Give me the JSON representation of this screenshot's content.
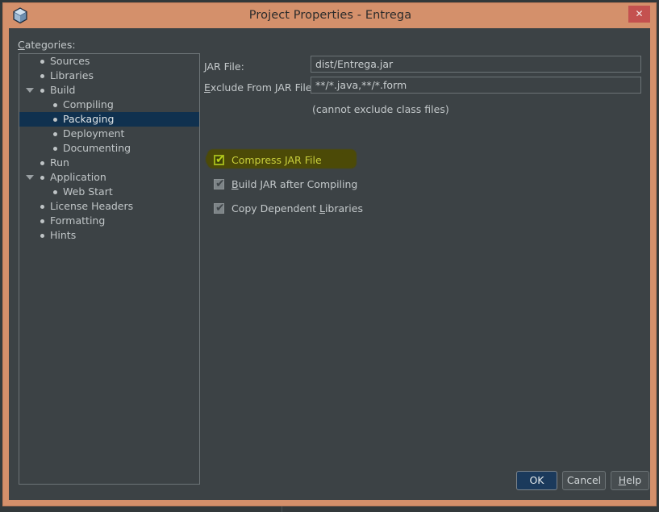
{
  "window": {
    "title": "Project Properties - Entrega",
    "app_icon": "cube-icon",
    "close_label": "✕",
    "frame_color": "#d4906b",
    "content_bg": "#3c4245"
  },
  "categories": {
    "label_prefix": "C",
    "label_rest": "ategories:",
    "items": [
      {
        "label": "Sources",
        "depth": 1,
        "expander": "",
        "selected": false
      },
      {
        "label": "Libraries",
        "depth": 1,
        "expander": "",
        "selected": false
      },
      {
        "label": "Build",
        "depth": 1,
        "expander": "expanded",
        "selected": false
      },
      {
        "label": "Compiling",
        "depth": 2,
        "expander": "",
        "selected": false
      },
      {
        "label": "Packaging",
        "depth": 2,
        "expander": "",
        "selected": true
      },
      {
        "label": "Deployment",
        "depth": 2,
        "expander": "",
        "selected": false
      },
      {
        "label": "Documenting",
        "depth": 2,
        "expander": "",
        "selected": false
      },
      {
        "label": "Run",
        "depth": 1,
        "expander": "",
        "selected": false
      },
      {
        "label": "Application",
        "depth": 1,
        "expander": "expanded",
        "selected": false
      },
      {
        "label": "Web Start",
        "depth": 2,
        "expander": "",
        "selected": false
      },
      {
        "label": "License Headers",
        "depth": 1,
        "expander": "",
        "selected": false
      },
      {
        "label": "Formatting",
        "depth": 1,
        "expander": "",
        "selected": false
      },
      {
        "label": "Hints",
        "depth": 1,
        "expander": "",
        "selected": false
      }
    ]
  },
  "form": {
    "jar_file": {
      "mnemonic": "J",
      "label_rest": "AR File:",
      "value": "dist/Entrega.jar",
      "placeholder": ""
    },
    "exclude_from_jar": {
      "mnemonic": "E",
      "label_rest": "xclude From JAR File:",
      "value": "**/*.java,**/*.form",
      "placeholder": ""
    },
    "note": "(cannot exclude class files)"
  },
  "checkboxes": [
    {
      "name": "compress-jar-file",
      "mnemonic": "",
      "label": "Compress JAR File",
      "checked": true,
      "check_glyph": "✔",
      "highlighted": true,
      "highlight_color": "#4c4a07",
      "text_color": "#c9cf3c"
    },
    {
      "name": "build-jar-after-compiling",
      "mnemonic": "B",
      "label": "Build JAR after Compiling",
      "checked": true,
      "check_glyph": "✔",
      "highlighted": false
    },
    {
      "name": "copy-dependent-libraries",
      "mnemonic": "",
      "label": "Copy Dependent Libraries",
      "checked": true,
      "check_glyph": "✔",
      "highlighted": false
    }
  ],
  "buttons": {
    "ok": "OK",
    "cancel": "Cancel",
    "help_mnemonic": "H",
    "help_rest": "elp",
    "ok_bg": "#1b3a5c"
  }
}
